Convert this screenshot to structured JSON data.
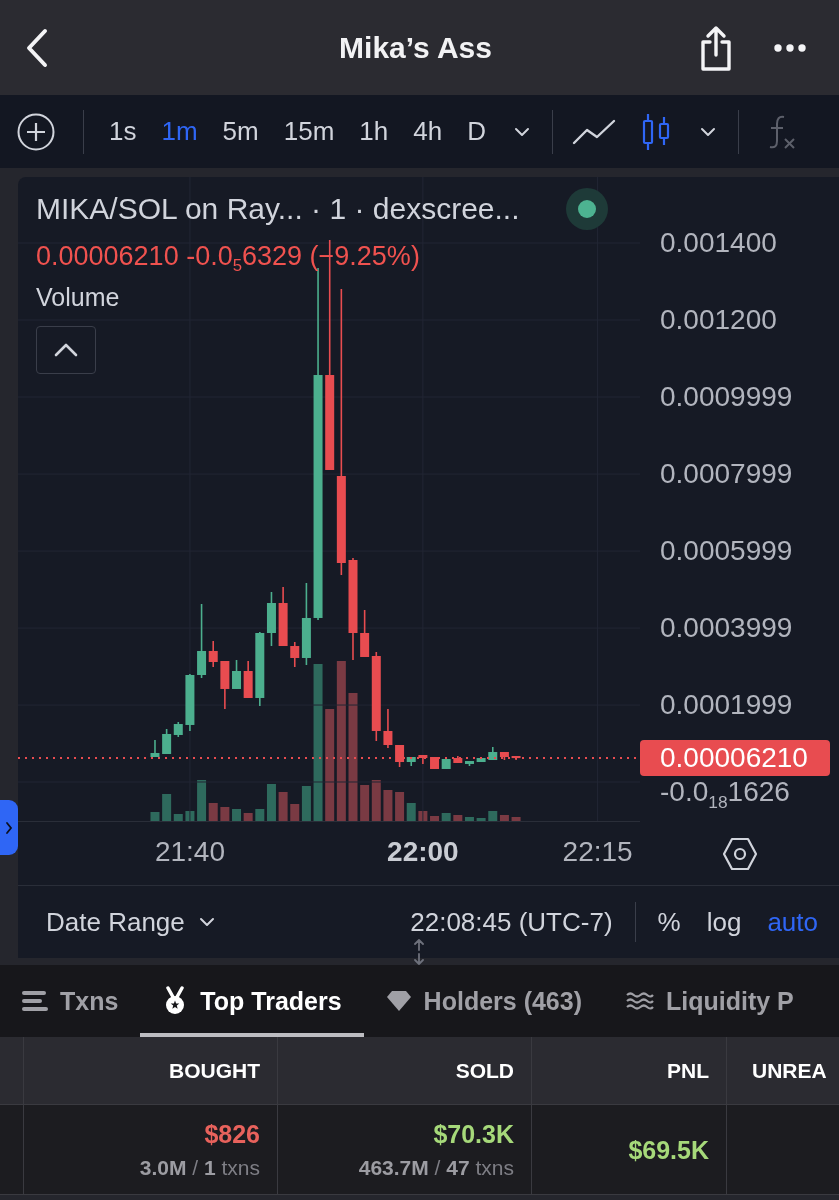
{
  "header": {
    "title": "Mika’s Ass"
  },
  "toolbar": {
    "intervals": [
      {
        "label": "1s",
        "selected": false
      },
      {
        "label": "1m",
        "selected": true
      },
      {
        "label": "5m",
        "selected": false
      },
      {
        "label": "15m",
        "selected": false
      },
      {
        "label": "1h",
        "selected": false
      },
      {
        "label": "4h",
        "selected": false
      },
      {
        "label": "D",
        "selected": false
      }
    ],
    "chart_types": [
      {
        "kind": "line",
        "selected": false
      },
      {
        "kind": "candles",
        "selected": true
      }
    ]
  },
  "chart": {
    "legend_title": "MIKA/SOL on Ray... · 1 · dexscree...",
    "price_change": "0.00006210 -0.0$_{5}$6329 (−9.25%)",
    "negative": true,
    "volume_label": "Volume",
    "chart_data": {
      "type": "candlestick",
      "x": [
        1297,
        1298,
        1299,
        1300,
        1301,
        1302,
        1303,
        1304,
        1305,
        1306,
        1307,
        1308,
        1309,
        1310,
        1311,
        1312,
        1313,
        1314,
        1315,
        1316,
        1317,
        1318,
        1319,
        1320,
        1321,
        1322,
        1323,
        1324,
        1325,
        1326,
        1327,
        1328
      ],
      "ohlc": [
        [
          6.49e-05,
          0.0001091,
          6.49e-05,
          7.53e-05
        ],
        [
          7.27e-05,
          0.0001377,
          7.27e-05,
          0.0001247
        ],
        [
          0.0001221,
          0.0001558,
          0.0001169,
          0.0001506
        ],
        [
          0.0001481,
          0.0002805,
          0.0001325,
          0.0002779
        ],
        [
          0.0002779,
          0.0004623,
          0.0002701,
          0.0003403
        ],
        [
          0.0003403,
          0.0003662,
          0.0002987,
          0.0003117
        ],
        [
          0.0003143,
          0.0003143,
          0.0001896,
          0.0002416
        ],
        [
          0.0002416,
          0.0003169,
          0.0002416,
          0.0002883
        ],
        [
          0.0002883,
          0.0003143,
          0.0002182,
          0.0002182
        ],
        [
          0.0002182,
          0.0003896,
          0.0001974,
          0.000387
        ],
        [
          0.000387,
          0.0004935,
          0.0003532,
          0.0004649
        ],
        [
          0.0004649,
          0.0005065,
          0.0003532,
          0.0003532
        ],
        [
          0.0003532,
          0.0003636,
          0.0002987,
          0.0003221
        ],
        [
          0.0003221,
          0.0005169,
          0.0003039,
          0.000426
        ],
        [
          0.000426,
          0.0013351,
          0.0004208,
          0.0010571
        ],
        [
          0.0010571,
          0.0014078,
          0.0008104,
          0.0008104
        ],
        [
          0.0007948,
          0.0012805,
          0.0005377,
          0.0005688
        ],
        [
          0.0005766,
          0.0005818,
          0.0003169,
          0.000387
        ],
        [
          0.000387,
          0.0004468,
          0.0003247,
          0.0003247
        ],
        [
          0.0003273,
          0.0003377,
          0.0001065,
          0.0001325
        ],
        [
          0.0001325,
          0.0001896,
          8.83e-05,
          9.61e-05
        ],
        [
          9.61e-05,
          9.61e-05,
          3.9e-05,
          5.19e-05
        ],
        [
          5.19e-05,
          6.49e-05,
          4.16e-05,
          6.49e-05
        ],
        [
          7.01e-05,
          7.01e-05,
          4.68e-05,
          6.23e-05
        ],
        [
          6.49e-05,
          6.49e-05,
          3.38e-05,
          3.38e-05
        ],
        [
          3.38e-05,
          5.97e-05,
          3.38e-05,
          5.97e-05
        ],
        [
          6.23e-05,
          6.75e-05,
          4.94e-05,
          4.94e-05
        ],
        [
          4.68e-05,
          5.45e-05,
          4.16e-05,
          5.45e-05
        ],
        [
          5.19e-05,
          6.23e-05,
          5.19e-05,
          6.23e-05
        ],
        [
          5.71e-05,
          9.09e-05,
          5.71e-05,
          7.79e-05
        ],
        [
          7.79e-05,
          7.79e-05,
          5.71e-05,
          6.49e-05
        ],
        [
          6.75e-05,
          6.75e-05,
          5.71e-05,
          6.21e-05
        ]
      ],
      "xlim": [
        1285.24,
        1338.64
      ],
      "ylim": [
        -0.0001039,
        0.0015714
      ],
      "grid": true,
      "xticks": [
        {
          "value": 1300,
          "label": "21:40"
        },
        {
          "value": 1320,
          "label": "22:00"
        },
        {
          "value": 1335,
          "label": "22:15"
        }
      ],
      "yticks": [
        {
          "value": 0.0014,
          "label": "0.001400"
        },
        {
          "value": 0.0012,
          "label": "0.001200"
        },
        {
          "value": 0.0009999,
          "label": "0.0009999"
        },
        {
          "value": 0.0007999,
          "label": "0.0007999"
        },
        {
          "value": 0.0005999,
          "label": "0.0005999"
        },
        {
          "value": 0.0003999,
          "label": "0.0003999"
        },
        {
          "value": 0.0001999,
          "label": "0.0001999"
        },
        {
          "value": -1.626e-19,
          "label": "-0.0$_{18}$1626"
        }
      ],
      "ref_lines": [
        {
          "axis": "y",
          "value": 6.21e-05,
          "label": "0.00006210",
          "color": "#e84c50"
        }
      ]
    }
  },
  "range_bar": {
    "date_range": "Date Range",
    "time": "22:08:45 (UTC-7)",
    "scale_options": [
      {
        "label": "%",
        "selected": false
      },
      {
        "label": "log",
        "selected": false
      },
      {
        "label": "auto",
        "selected": true
      }
    ]
  },
  "tabs": [
    {
      "kind": "list",
      "label": "Txns",
      "selected": false
    },
    {
      "kind": "medal",
      "label": "Top Traders",
      "selected": true
    },
    {
      "kind": "diamond",
      "label": "Holders (463)",
      "selected": false
    },
    {
      "kind": "waves",
      "label": "Liquidity P",
      "selected": false
    }
  ],
  "table": {
    "columns": [
      "BOUGHT",
      "SOLD",
      "PNL",
      "UNREA"
    ],
    "rows": [
      {
        "cells": [
          {
            "value": "$826",
            "detail": "**3.0M** / **1** txns",
            "negative": true
          },
          {
            "value": "$70.3K",
            "detail": "**463.7M** / **47** txns",
            "negative": false
          },
          {
            "value": "$69.5K",
            "negative": false
          }
        ]
      }
    ]
  }
}
